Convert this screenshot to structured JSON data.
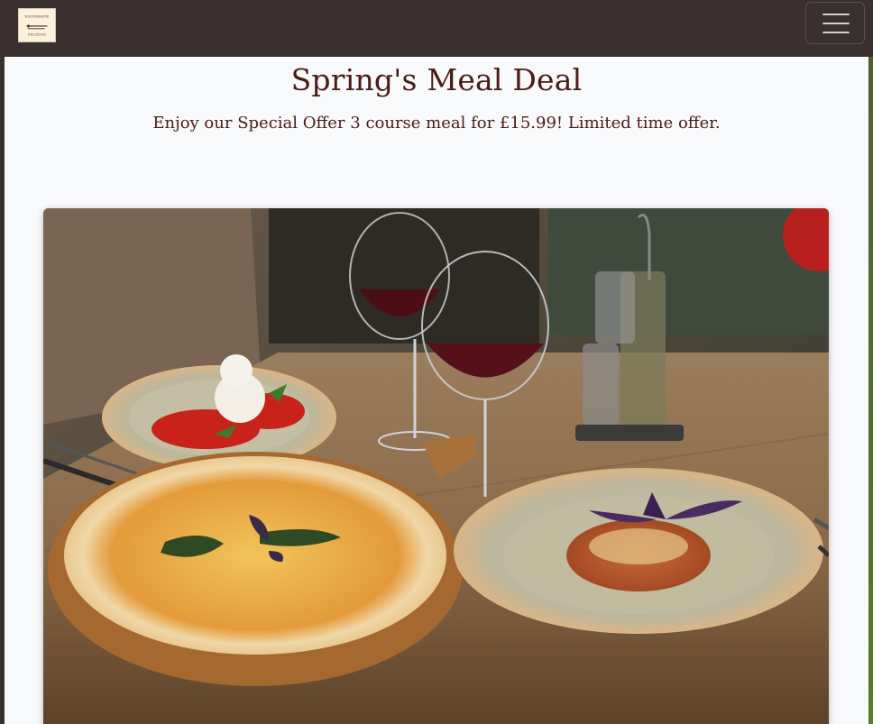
{
  "navbar": {
    "logo_text_top": "RISTORANTE",
    "logo_text_bottom": "DELIZIOSO",
    "menu_toggle_icon": "hamburger-icon"
  },
  "hero": {
    "title": "Spring's Meal Deal",
    "subtitle": "Enjoy our Special Offer 3 course meal for £15.99! Limited time offer."
  },
  "image": {
    "description_icon": "meal-photo"
  },
  "colors": {
    "navbar_bg": "#3a3030",
    "page_bg": "#f8f9fb",
    "title_color": "#4a1c16"
  }
}
